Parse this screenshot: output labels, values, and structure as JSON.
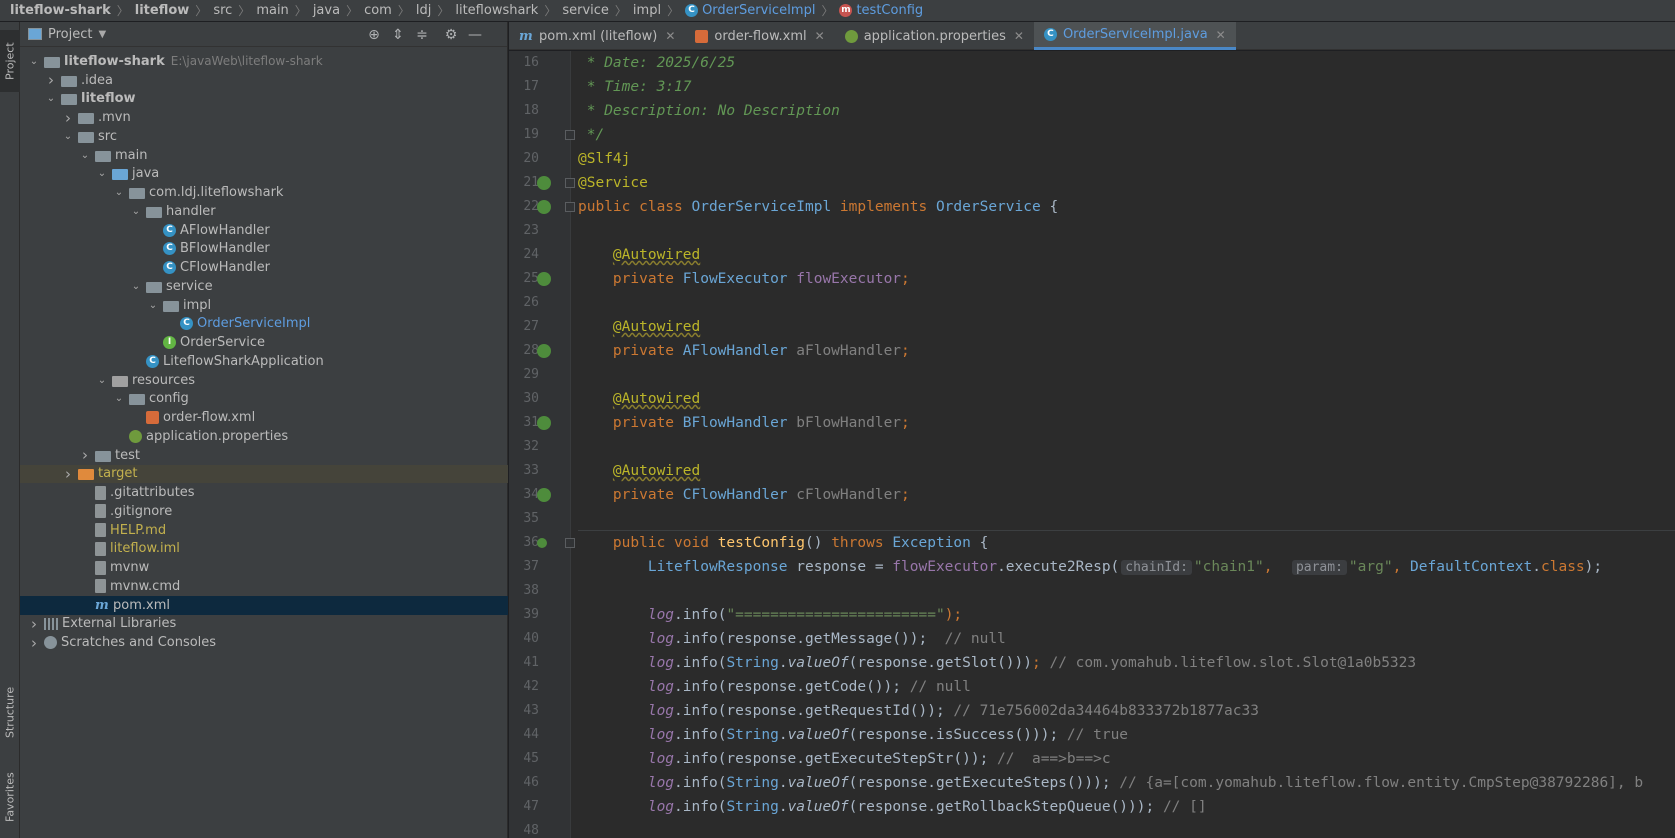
{
  "breadcrumb": {
    "items": [
      "liteflow-shark",
      "liteflow",
      "src",
      "main",
      "java",
      "com",
      "ldj",
      "liteflowshark",
      "service",
      "impl"
    ],
    "class_item": "OrderServiceImpl",
    "method_item": "testConfig"
  },
  "left_strip": {
    "project": "Project",
    "structure": "Structure",
    "favorites": "Favorites"
  },
  "project_panel": {
    "title": "Project",
    "root_path": "E:\\javaWeb\\liteflow-shark",
    "tree": [
      {
        "label": "liteflow-shark",
        "depth": 0,
        "arrow": "down",
        "icon": "folder",
        "bold": true
      },
      {
        "label": ".idea",
        "depth": 1,
        "arrow": "right",
        "icon": "folder"
      },
      {
        "label": "liteflow",
        "depth": 1,
        "arrow": "down",
        "icon": "folder",
        "bold": true
      },
      {
        "label": ".mvn",
        "depth": 2,
        "arrow": "right",
        "icon": "folder"
      },
      {
        "label": "src",
        "depth": 2,
        "arrow": "down",
        "icon": "folder"
      },
      {
        "label": "main",
        "depth": 3,
        "arrow": "down",
        "icon": "folder"
      },
      {
        "label": "java",
        "depth": 4,
        "arrow": "down",
        "icon": "folder-blue"
      },
      {
        "label": "com.ldj.liteflowshark",
        "depth": 5,
        "arrow": "down",
        "icon": "folder"
      },
      {
        "label": "handler",
        "depth": 6,
        "arrow": "down",
        "icon": "folder"
      },
      {
        "label": "AFlowHandler",
        "depth": 7,
        "arrow": "",
        "icon": "class"
      },
      {
        "label": "BFlowHandler",
        "depth": 7,
        "arrow": "",
        "icon": "class"
      },
      {
        "label": "CFlowHandler",
        "depth": 7,
        "arrow": "",
        "icon": "class"
      },
      {
        "label": "service",
        "depth": 6,
        "arrow": "down",
        "icon": "folder"
      },
      {
        "label": "impl",
        "depth": 7,
        "arrow": "down",
        "icon": "folder"
      },
      {
        "label": "OrderServiceImpl",
        "depth": 8,
        "arrow": "",
        "icon": "class",
        "color": "blue"
      },
      {
        "label": "OrderService",
        "depth": 7,
        "arrow": "",
        "icon": "interface"
      },
      {
        "label": "LiteflowSharkApplication",
        "depth": 6,
        "arrow": "",
        "icon": "class"
      },
      {
        "label": "resources",
        "depth": 4,
        "arrow": "down",
        "icon": "folder-res"
      },
      {
        "label": "config",
        "depth": 5,
        "arrow": "down",
        "icon": "folder"
      },
      {
        "label": "order-flow.xml",
        "depth": 6,
        "arrow": "",
        "icon": "xml"
      },
      {
        "label": "application.properties",
        "depth": 5,
        "arrow": "",
        "icon": "properties"
      },
      {
        "label": "test",
        "depth": 3,
        "arrow": "right",
        "icon": "folder"
      },
      {
        "label": "target",
        "depth": 2,
        "arrow": "right",
        "icon": "folder-orange",
        "color": "yellow",
        "row": "target"
      },
      {
        "label": ".gitattributes",
        "depth": 3,
        "arrow": "",
        "icon": "file"
      },
      {
        "label": ".gitignore",
        "depth": 3,
        "arrow": "",
        "icon": "file"
      },
      {
        "label": "HELP.md",
        "depth": 3,
        "arrow": "",
        "icon": "file",
        "color": "yellow"
      },
      {
        "label": "liteflow.iml",
        "depth": 3,
        "arrow": "",
        "icon": "file",
        "color": "yellow"
      },
      {
        "label": "mvnw",
        "depth": 3,
        "arrow": "",
        "icon": "file"
      },
      {
        "label": "mvnw.cmd",
        "depth": 3,
        "arrow": "",
        "icon": "file"
      },
      {
        "label": "pom.xml",
        "depth": 3,
        "arrow": "",
        "icon": "maven",
        "row": "selected"
      },
      {
        "label": "External Libraries",
        "depth": 0,
        "arrow": "right",
        "icon": "library"
      },
      {
        "label": "Scratches and Consoles",
        "depth": 0,
        "arrow": "right",
        "icon": "scratch"
      }
    ]
  },
  "editor_tabs": [
    {
      "label": "pom.xml (liteflow)",
      "icon": "maven",
      "active": false
    },
    {
      "label": "order-flow.xml",
      "icon": "xml",
      "active": false
    },
    {
      "label": "application.properties",
      "icon": "properties",
      "active": false
    },
    {
      "label": "OrderServiceImpl.java",
      "icon": "class",
      "active": true
    }
  ],
  "editor": {
    "lines": [
      {
        "n": "16",
        "gutter": "",
        "parts": [
          [
            " * Date: 2025/6/25",
            "cmt-doc"
          ]
        ]
      },
      {
        "n": "17",
        "gutter": "",
        "parts": [
          [
            " * Time: 3:17",
            "cmt-doc"
          ]
        ]
      },
      {
        "n": "18",
        "gutter": "",
        "parts": [
          [
            " * Description: No Description",
            "cmt-doc"
          ]
        ]
      },
      {
        "n": "19",
        "gutter": "fold",
        "parts": [
          [
            " */",
            "cmt-doc"
          ]
        ]
      },
      {
        "n": "20",
        "gutter": "",
        "parts": [
          [
            "@Slf4j",
            "ann"
          ]
        ]
      },
      {
        "n": "21",
        "gutter": "bean",
        "parts": [
          [
            "@Service",
            "ann"
          ]
        ]
      },
      {
        "n": "22",
        "gutter": "bean",
        "parts": [
          [
            "public class ",
            "kw"
          ],
          [
            "OrderServiceImpl",
            "cls-n"
          ],
          [
            " implements ",
            "kw"
          ],
          [
            "OrderService",
            "cls-n"
          ],
          [
            " {",
            ""
          ]
        ]
      },
      {
        "n": "23",
        "gutter": "",
        "parts": []
      },
      {
        "n": "24",
        "gutter": "",
        "parts": [
          [
            "    ",
            ""
          ],
          [
            "@Autowired",
            "ann sq"
          ]
        ]
      },
      {
        "n": "25",
        "gutter": "bean",
        "parts": [
          [
            "    private ",
            "kw"
          ],
          [
            "FlowExecutor",
            "cls-n"
          ],
          [
            " ",
            ""
          ],
          [
            "flowExecutor",
            "fld"
          ],
          [
            ";",
            "kw"
          ]
        ]
      },
      {
        "n": "26",
        "gutter": "",
        "parts": []
      },
      {
        "n": "27",
        "gutter": "",
        "parts": [
          [
            "    ",
            ""
          ],
          [
            "@Autowired",
            "ann sq"
          ]
        ]
      },
      {
        "n": "28",
        "gutter": "bean",
        "parts": [
          [
            "    private ",
            "kw"
          ],
          [
            "AFlowHandler",
            "cls-n"
          ],
          [
            " ",
            ""
          ],
          [
            "aFlowHandler",
            "fld-u"
          ],
          [
            ";",
            "kw"
          ]
        ]
      },
      {
        "n": "29",
        "gutter": "",
        "parts": []
      },
      {
        "n": "30",
        "gutter": "",
        "parts": [
          [
            "    ",
            ""
          ],
          [
            "@Autowired",
            "ann sq"
          ]
        ]
      },
      {
        "n": "31",
        "gutter": "bean",
        "parts": [
          [
            "    private ",
            "kw"
          ],
          [
            "BFlowHandler",
            "cls-n"
          ],
          [
            " ",
            ""
          ],
          [
            "bFlowHandler",
            "fld-u"
          ],
          [
            ";",
            "kw"
          ]
        ]
      },
      {
        "n": "32",
        "gutter": "",
        "parts": []
      },
      {
        "n": "33",
        "gutter": "",
        "parts": [
          [
            "    ",
            ""
          ],
          [
            "@Autowired",
            "ann sq"
          ]
        ]
      },
      {
        "n": "34",
        "gutter": "bean",
        "parts": [
          [
            "    private ",
            "kw"
          ],
          [
            "CFlowHandler",
            "cls-n"
          ],
          [
            " ",
            ""
          ],
          [
            "cFlowHandler",
            "fld-u"
          ],
          [
            ";",
            "kw"
          ]
        ]
      },
      {
        "n": "35",
        "gutter": "",
        "parts": []
      },
      {
        "n": "36",
        "gutter": "impl",
        "parts": [
          [
            "    public void ",
            "kw"
          ],
          [
            "testConfig",
            "meth"
          ],
          [
            "() ",
            ""
          ],
          [
            "throws ",
            "kw"
          ],
          [
            "Exception",
            "cls-n"
          ],
          [
            " {",
            ""
          ]
        ]
      },
      {
        "n": "37",
        "gutter": "",
        "parts": [
          [
            "        ",
            ""
          ],
          [
            "LiteflowResponse",
            "cls-n"
          ],
          [
            " response = ",
            ""
          ],
          [
            "flowExecutor",
            "fld"
          ],
          [
            ".execute2Resp(",
            ""
          ],
          [
            "chainId:",
            "hint"
          ],
          [
            "\"chain1\"",
            "str"
          ],
          [
            ",  ",
            "kw"
          ],
          [
            "param:",
            "hint"
          ],
          [
            "\"arg\"",
            "str"
          ],
          [
            ", ",
            "kw"
          ],
          [
            "DefaultContext",
            "cls-n"
          ],
          [
            ".",
            ""
          ],
          [
            "class",
            "kw"
          ],
          [
            ");",
            ""
          ]
        ]
      },
      {
        "n": "38",
        "gutter": "",
        "parts": []
      },
      {
        "n": "39",
        "gutter": "",
        "parts": [
          [
            "        ",
            ""
          ],
          [
            "log",
            "static"
          ],
          [
            ".info(",
            ""
          ],
          [
            "\"=======================\"",
            "str"
          ],
          [
            ");",
            "kw"
          ]
        ]
      },
      {
        "n": "40",
        "gutter": "",
        "parts": [
          [
            "        ",
            ""
          ],
          [
            "log",
            "static"
          ],
          [
            ".info(response.getMessage());",
            ""
          ],
          [
            "  // null",
            "cmt"
          ]
        ]
      },
      {
        "n": "41",
        "gutter": "",
        "parts": [
          [
            "        ",
            ""
          ],
          [
            "log",
            "static"
          ],
          [
            ".info(",
            ""
          ],
          [
            "String",
            "cls-n"
          ],
          [
            ".",
            ""
          ],
          [
            "valueOf",
            "stat-m"
          ],
          [
            "(response.getSlot()))",
            ""
          ],
          [
            "; ",
            "kw"
          ],
          [
            "// com.yomahub.liteflow.slot.Slot@1a0b5323",
            "cmt"
          ]
        ]
      },
      {
        "n": "42",
        "gutter": "",
        "parts": [
          [
            "        ",
            ""
          ],
          [
            "log",
            "static"
          ],
          [
            ".info(response.getCode());",
            ""
          ],
          [
            " // null",
            "cmt"
          ]
        ]
      },
      {
        "n": "43",
        "gutter": "",
        "parts": [
          [
            "        ",
            ""
          ],
          [
            "log",
            "static"
          ],
          [
            ".info(response.getRequestId());",
            ""
          ],
          [
            " // 71e756002da34464b833372b1877ac33",
            "cmt"
          ]
        ]
      },
      {
        "n": "44",
        "gutter": "",
        "parts": [
          [
            "        ",
            ""
          ],
          [
            "log",
            "static"
          ],
          [
            ".info(",
            ""
          ],
          [
            "String",
            "cls-n"
          ],
          [
            ".",
            ""
          ],
          [
            "valueOf",
            "stat-m"
          ],
          [
            "(response.isSuccess()));",
            ""
          ],
          [
            " // true",
            "cmt"
          ]
        ]
      },
      {
        "n": "45",
        "gutter": "",
        "parts": [
          [
            "        ",
            ""
          ],
          [
            "log",
            "static"
          ],
          [
            ".info(response.getExecuteStepStr());",
            ""
          ],
          [
            " //  a==>b==>c",
            "cmt"
          ]
        ]
      },
      {
        "n": "46",
        "gutter": "",
        "parts": [
          [
            "        ",
            ""
          ],
          [
            "log",
            "static"
          ],
          [
            ".info(",
            ""
          ],
          [
            "String",
            "cls-n"
          ],
          [
            ".",
            ""
          ],
          [
            "valueOf",
            "stat-m"
          ],
          [
            "(response.getExecuteSteps()));",
            ""
          ],
          [
            " // {a=[com.yomahub.liteflow.flow.entity.CmpStep@38792286], b",
            "cmt"
          ]
        ]
      },
      {
        "n": "47",
        "gutter": "",
        "parts": [
          [
            "        ",
            ""
          ],
          [
            "log",
            "static"
          ],
          [
            ".info(",
            ""
          ],
          [
            "String",
            "cls-n"
          ],
          [
            ".",
            ""
          ],
          [
            "valueOf",
            "stat-m"
          ],
          [
            "(response.getRollbackStepQueue()));",
            ""
          ],
          [
            " // []",
            "cmt"
          ]
        ]
      },
      {
        "n": "48",
        "gutter": "",
        "parts": []
      }
    ]
  }
}
